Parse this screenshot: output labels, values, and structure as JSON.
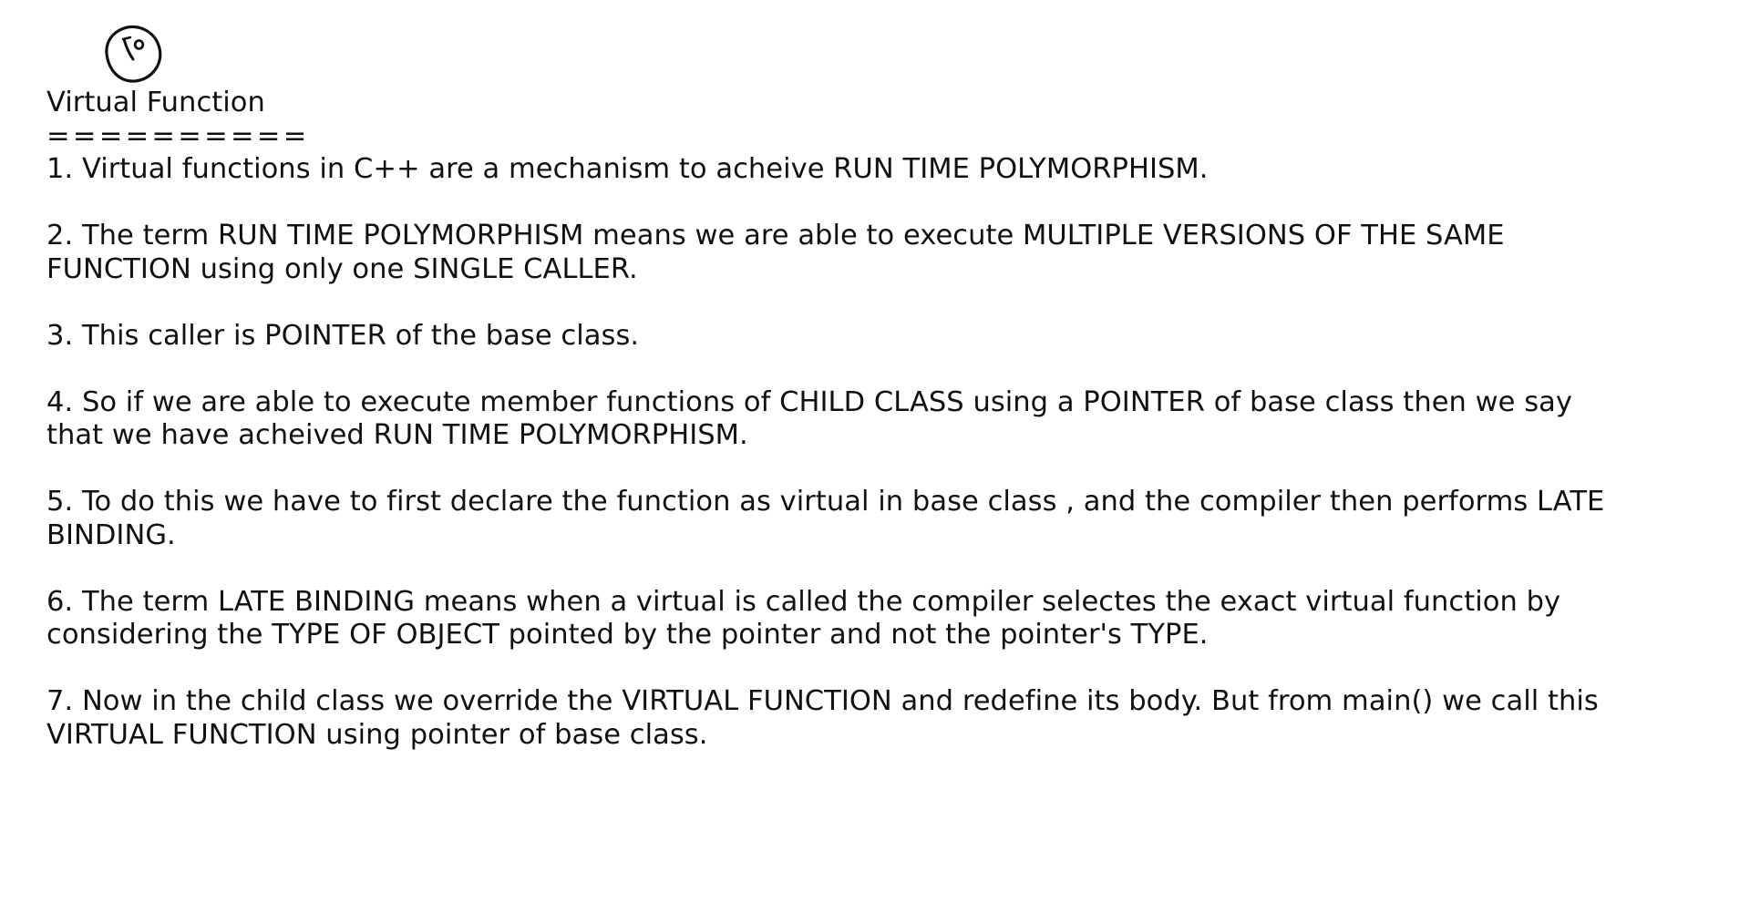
{
  "page_marker": {
    "handwritten_number": "10",
    "icon": "handwritten-circled-page-number"
  },
  "note": {
    "title": "Virtual Function",
    "title_underline": "==========",
    "points": [
      "1. Virtual functions in C++ are a mechanism to acheive RUN TIME POLYMORPHISM.",
      "2. The term RUN TIME POLYMORPHISM means we are able to execute MULTIPLE VERSIONS OF THE SAME FUNCTION using only one SINGLE CALLER.",
      "3. This caller is POINTER of the base class.",
      "4. So if we are able to execute member functions of CHILD CLASS using a POINTER of base class then we say that we have acheived RUN TIME POLYMORPHISM.",
      "5. To do this we have to first declare the function as virtual in base class , and the compiler then performs LATE BINDING.",
      "6. The term LATE BINDING means when a virtual is called the compiler selectes the exact virtual function by considering the TYPE OF OBJECT pointed by the pointer and not the pointer's TYPE.",
      "7. Now in the child class we override the VIRTUAL FUNCTION and redefine its body. But from main() we call this VIRTUAL FUNCTION using pointer of base class."
    ]
  }
}
